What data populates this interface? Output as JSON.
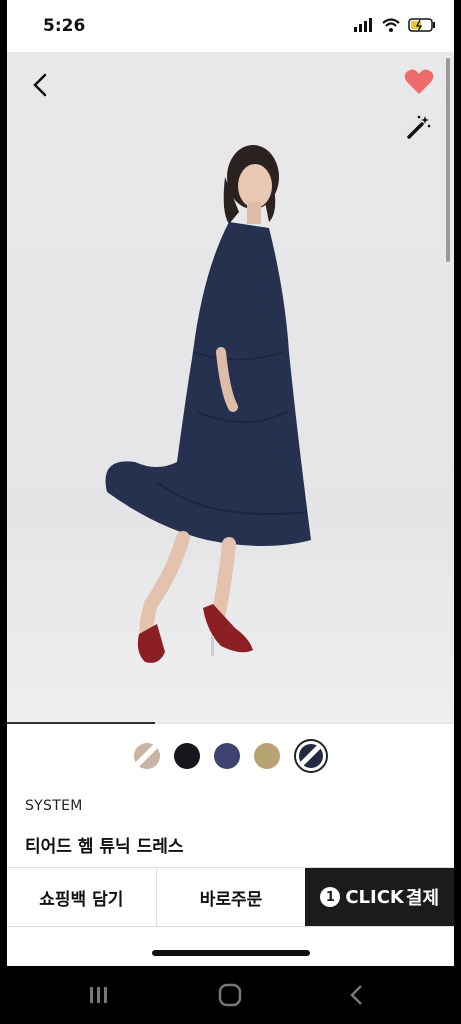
{
  "status_bar": {
    "time": "5:26"
  },
  "product": {
    "brand": "SYSTEM",
    "name": "티어드 헴 튜닉 드레스",
    "image_progress": 0.33
  },
  "swatches": [
    {
      "color": "#c8b4a4",
      "pattern": "striped"
    },
    {
      "color": "#15171c"
    },
    {
      "color": "#3d4270"
    },
    {
      "color": "#b8a373"
    },
    {
      "color": "#222a44",
      "selected": true,
      "pattern": "striped"
    }
  ],
  "actions": {
    "shopping_bag": "쇼핑백 담기",
    "buy_now": "바로주문",
    "one_click_badge": "1",
    "one_click_text": "CLICK",
    "one_click_pay": "결제"
  },
  "colors": {
    "heart": "#ef6a6a",
    "button_dark": "#1b1b1b"
  }
}
